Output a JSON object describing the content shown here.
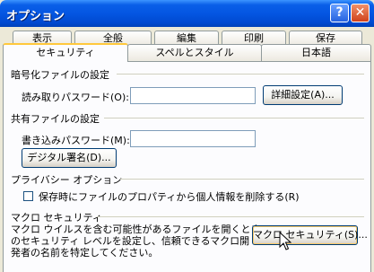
{
  "window": {
    "title": "オプション",
    "help_button": "?",
    "close_button": "✕"
  },
  "tabs": {
    "row1": [
      {
        "label": "表示"
      },
      {
        "label": "全般"
      },
      {
        "label": "編集"
      },
      {
        "label": "印刷"
      },
      {
        "label": "保存"
      }
    ],
    "row2": [
      {
        "label": "セキュリティ",
        "active": true
      },
      {
        "label": "スペルとスタイル"
      },
      {
        "label": "日本語"
      }
    ]
  },
  "encryption": {
    "heading": "暗号化ファイルの設定",
    "read_password_label": "読み取りパスワード(O):",
    "read_password_value": "",
    "advanced_button": "詳細設定(A)..."
  },
  "sharing": {
    "heading": "共有ファイルの設定",
    "write_password_label": "書き込みパスワード(M):",
    "write_password_value": "",
    "digital_signature_button": "デジタル署名(D)..."
  },
  "privacy": {
    "heading": "プライバシー オプション",
    "remove_personal_info_label": "保存時にファイルのプロパティから個人情報を削除する(R)",
    "remove_personal_info_checked": false
  },
  "macro": {
    "heading": "マクロ セキュリティ",
    "description_lines": [
      "マクロ ウイルスを含む可能性があるファイルを開くとき",
      "のセキュリティ レベルを設定し、信頼できるマクロ開",
      "発者の名前を特定してください。"
    ],
    "macro_security_button": "マクロ セキュリティ(S)..."
  },
  "colors": {
    "title_bar": "#0456e2",
    "dialog_bg": "#ece9d8",
    "active_tab_highlight": "#ffc83c"
  }
}
